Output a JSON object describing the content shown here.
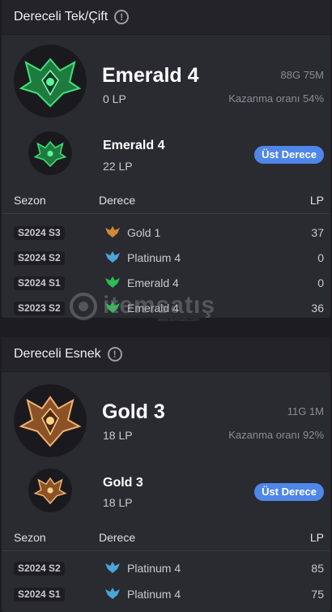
{
  "solo": {
    "title": "Dereceli Tek/Çift",
    "info_icon": "!",
    "rank": "Emerald 4",
    "lp": "0 LP",
    "games": "88G 75M",
    "winrate": "Kazanma oranı 54%",
    "peak_rank": "Emerald 4",
    "peak_lp": "22 LP",
    "peak_badge": "Üst Derece",
    "table_headers": {
      "season": "Sezon",
      "tier": "Derece",
      "lp": "LP"
    },
    "history": [
      {
        "season": "S2024 S3",
        "tier": "Gold 1",
        "lp": "37",
        "icon": "gold-tier-icon",
        "color": "#d08a36"
      },
      {
        "season": "S2024 S2",
        "tier": "Platinum 4",
        "lp": "0",
        "icon": "platinum-tier-icon",
        "color": "#4ca5d8"
      },
      {
        "season": "S2024 S1",
        "tier": "Emerald 4",
        "lp": "0",
        "icon": "emerald-tier-icon",
        "color": "#2fbb55"
      },
      {
        "season": "S2023 S2",
        "tier": "Emerald 4",
        "lp": "36",
        "icon": "emerald-tier-icon",
        "color": "#2fbb55"
      }
    ]
  },
  "flex": {
    "title": "Dereceli Esnek",
    "info_icon": "!",
    "rank": "Gold 3",
    "lp": "18 LP",
    "games": "11G 1M",
    "winrate": "Kazanma oranı 92%",
    "peak_rank": "Gold 3",
    "peak_lp": "18 LP",
    "peak_badge": "Üst Derece",
    "table_headers": {
      "season": "Sezon",
      "tier": "Derece",
      "lp": "LP"
    },
    "history": [
      {
        "season": "S2024 S2",
        "tier": "Platinum 4",
        "lp": "85",
        "icon": "platinum-tier-icon",
        "color": "#4ca5d8"
      },
      {
        "season": "S2024 S1",
        "tier": "Platinum 4",
        "lp": "75",
        "icon": "platinum-tier-icon",
        "color": "#4ca5d8"
      }
    ]
  },
  "watermark": {
    "text": "itemsatış",
    "sub": "www.itemsatis.com"
  },
  "colors": {
    "emerald": "#2fbb55",
    "gold": "#d08a36",
    "platinum": "#4ca5d8",
    "badge": "#4f87e8"
  }
}
